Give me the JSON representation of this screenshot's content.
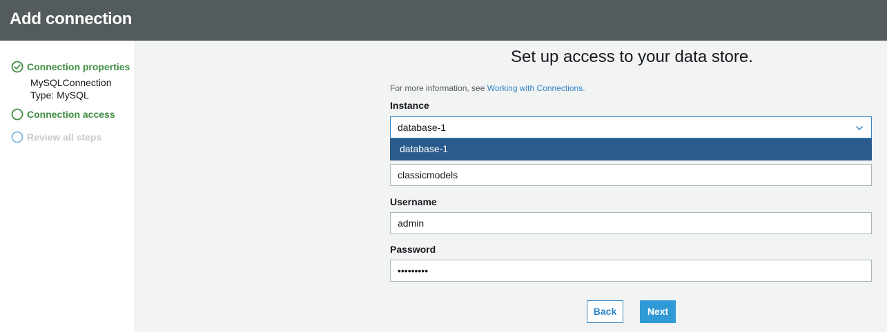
{
  "header": {
    "title": "Add connection"
  },
  "steps": [
    {
      "label": "Connection properties",
      "status": "complete",
      "details": [
        "MySQLConnection",
        "Type: MySQL"
      ]
    },
    {
      "label": "Connection access",
      "status": "current"
    },
    {
      "label": "Review all steps",
      "status": "pending"
    }
  ],
  "main": {
    "title": "Set up access to your data store.",
    "info_prefix": "For more information, see ",
    "info_link": "Working with Connections."
  },
  "form": {
    "instance": {
      "label": "Instance",
      "value": "database-1",
      "options": [
        "database-1"
      ]
    },
    "database": {
      "value": "classicmodels"
    },
    "username": {
      "label": "Username",
      "value": "admin"
    },
    "password": {
      "label": "Password",
      "value": "•••••••••"
    }
  },
  "buttons": {
    "back": "Back",
    "next": "Next"
  },
  "colors": {
    "header_bg": "#545b5d",
    "step_green": "#3e8e41",
    "step_pending": "#c7cbcf",
    "link": "#2f84c7",
    "dropdown_selected": "#2a5b8d",
    "primary_button": "#2f9ad6"
  }
}
